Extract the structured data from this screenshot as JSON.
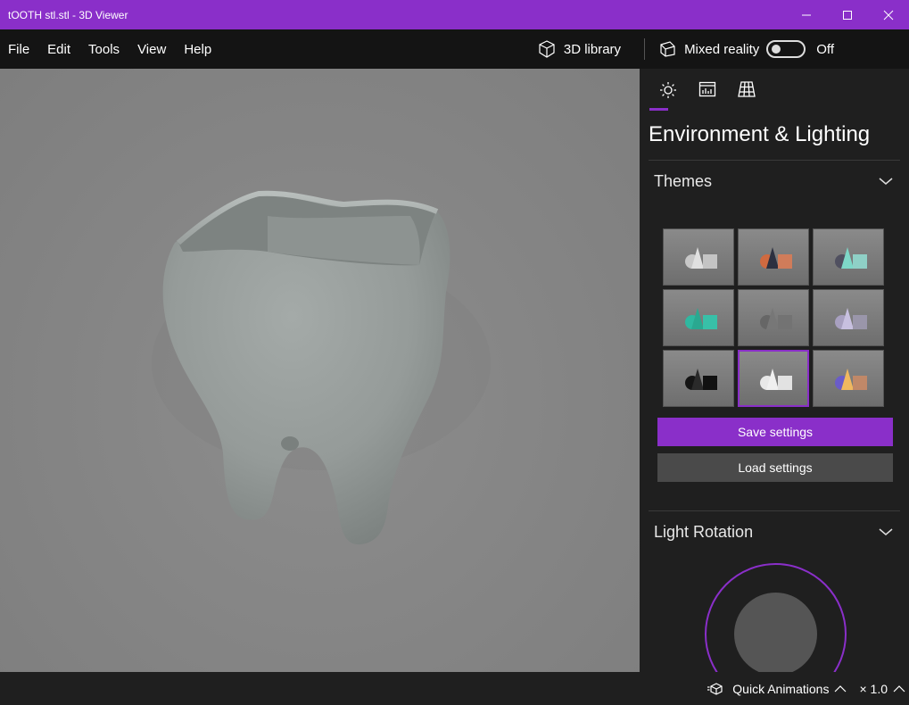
{
  "window": {
    "title": "tOOTH stl.stl - 3D Viewer"
  },
  "menu": {
    "items": [
      "File",
      "Edit",
      "Tools",
      "View",
      "Help"
    ]
  },
  "toolbar": {
    "library_label": "3D library",
    "mixed_reality_label": "Mixed reality",
    "mixed_reality_state": "Off"
  },
  "panel": {
    "title": "Environment & Lighting",
    "themes_label": "Themes",
    "save_label": "Save settings",
    "load_label": "Load settings",
    "light_rotation_label": "Light Rotation",
    "selected_theme_index": 7
  },
  "status": {
    "animations_label": "Quick Animations",
    "speed_label": "× 1.0"
  },
  "colors": {
    "accent": "#8a2fc9",
    "titlebar": "#8a2fc9",
    "panel": "#1f1f1f",
    "menubar": "#141414"
  },
  "icons": [
    "minimize-icon",
    "maximize-icon",
    "close-icon",
    "cube-icon",
    "mixed-reality-icon",
    "sun-icon",
    "stats-icon",
    "grid-icon",
    "chevron-down-icon",
    "animation-icon",
    "chevron-up-icon"
  ]
}
